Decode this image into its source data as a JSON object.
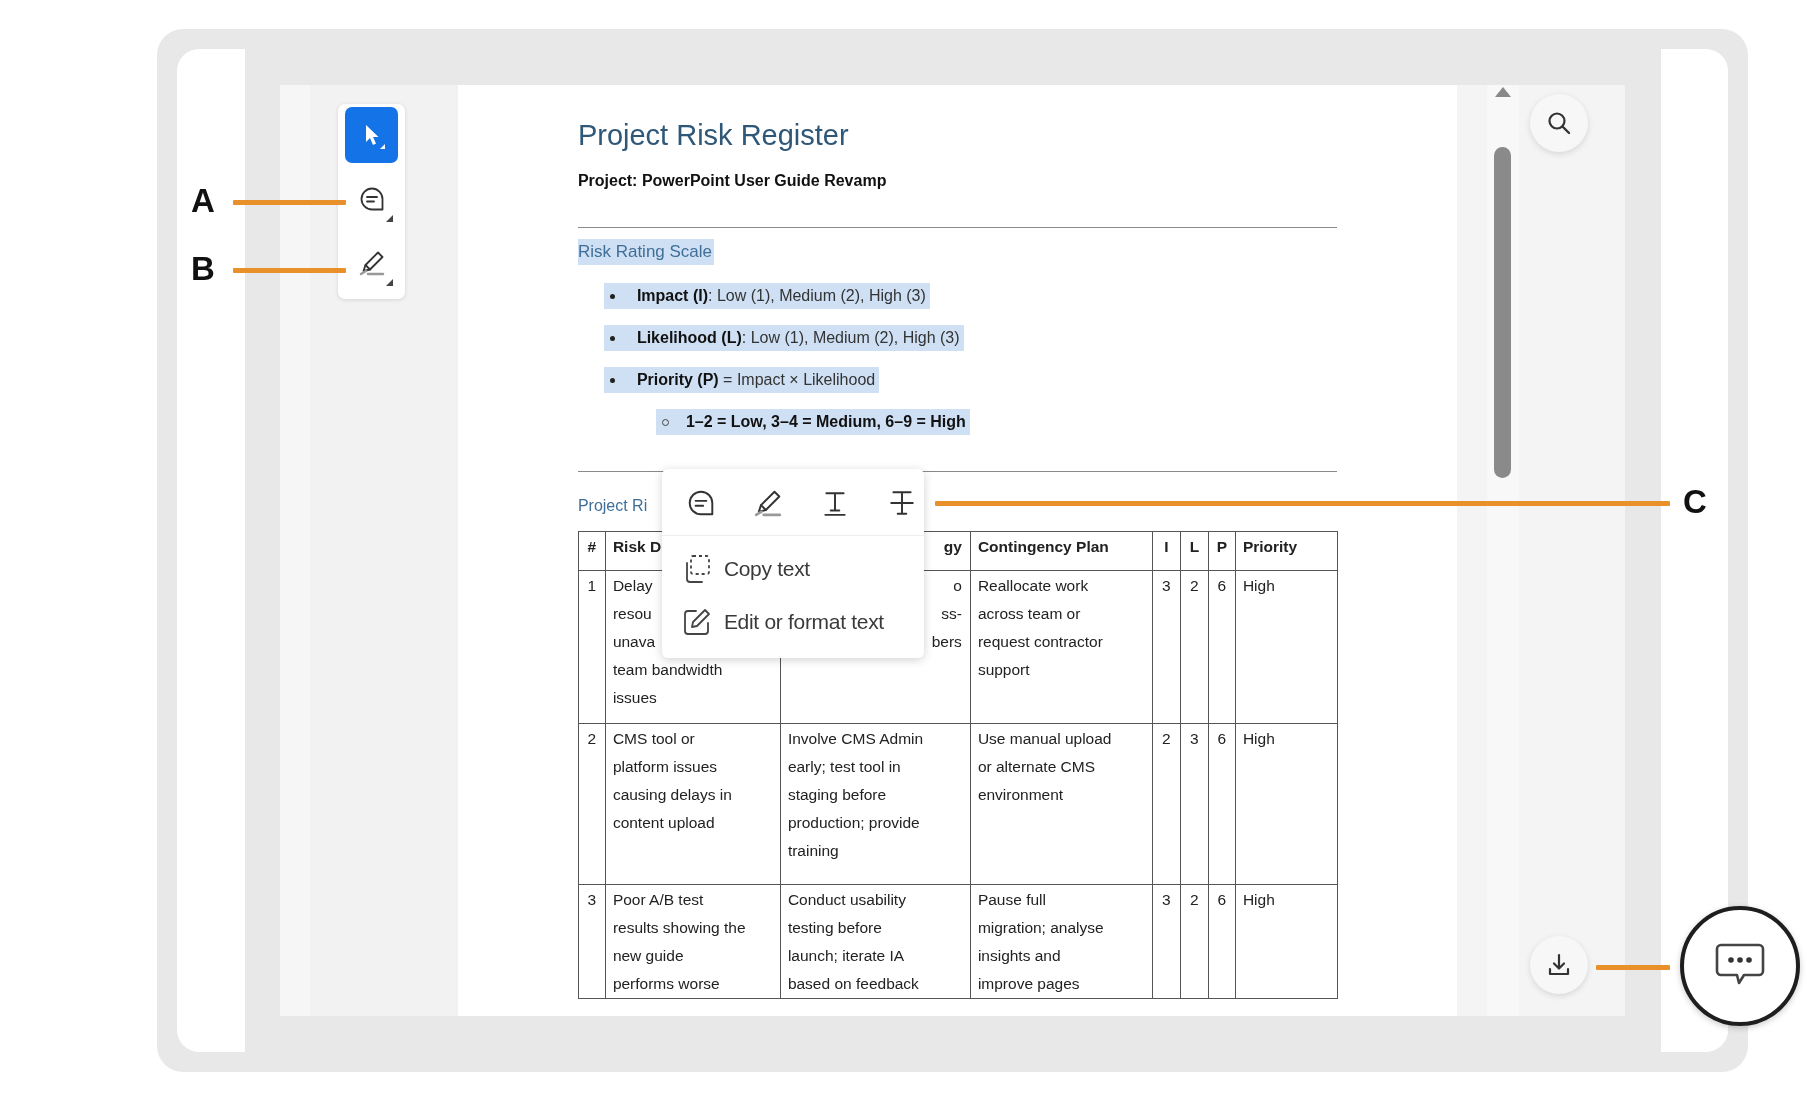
{
  "toolbar": {
    "tools": [
      {
        "kind": "select",
        "selected": true
      },
      {
        "kind": "comment",
        "selected": false
      },
      {
        "kind": "highlight",
        "selected": false
      }
    ]
  },
  "document": {
    "title": "Project Risk Register",
    "project": "Project: PowerPoint User Guide Revamp",
    "scale": {
      "heading": "Risk Rating Scale",
      "highlighted": true,
      "items": [
        {
          "text": "**Impact (I)**: Low (1), Medium (2), High (3)",
          "highlighted": true
        },
        {
          "text": "**Likelihood (L)**: Low (1), Medium (2), High (3)",
          "highlighted": true
        },
        {
          "text": "**Priority (P)** = Impact × Likelihood",
          "highlighted": true,
          "children": [
            {
              "text": "1–2 = Low, 3–4 = Medium, 6–9 = High",
              "highlighted": true
            }
          ]
        }
      ]
    },
    "register": {
      "heading": "Project Ri",
      "table": {
        "columns": [
          "#",
          "Risk D",
          "gy",
          "Contingency Plan",
          "I",
          "L",
          "P",
          "Priority"
        ],
        "rows": [
          [
            "1",
            "Delay\nresou\nunava\nteam bandwidth\nissues",
            "o\nss-\nbers",
            "Reallocate work\nacross team or\nrequest contractor\nsupport",
            "3",
            "2",
            "6",
            "High"
          ],
          [
            "2",
            "CMS tool or\nplatform issues\ncausing delays in\ncontent upload",
            "Involve CMS Admin\nearly; test tool in\nstaging before\nproduction; provide\ntraining",
            "Use manual upload\nor alternate CMS\nenvironment",
            "2",
            "3",
            "6",
            "High"
          ],
          [
            "3",
            "Poor A/B test\nresults showing the\nnew guide\nperforms worse",
            "Conduct usability\ntesting before\nlaunch; iterate IA\nbased on feedback",
            "Pause full\nmigration; analyse\ninsights and\nimprove pages",
            "3",
            "2",
            "6",
            "High"
          ]
        ]
      }
    }
  },
  "popup": {
    "tools": [
      {
        "kind": "comment"
      },
      {
        "kind": "highlight"
      },
      {
        "kind": "underline"
      },
      {
        "kind": "strikethrough"
      }
    ],
    "items": [
      {
        "kind": "copy",
        "label": "Copy text"
      },
      {
        "kind": "edit",
        "label": "Edit or format text"
      }
    ]
  },
  "rail": {
    "buttons": [
      {
        "kind": "search"
      },
      {
        "kind": "download"
      }
    ]
  },
  "callouts": [
    {
      "label": "A"
    },
    {
      "label": "B"
    },
    {
      "label": "C"
    }
  ]
}
